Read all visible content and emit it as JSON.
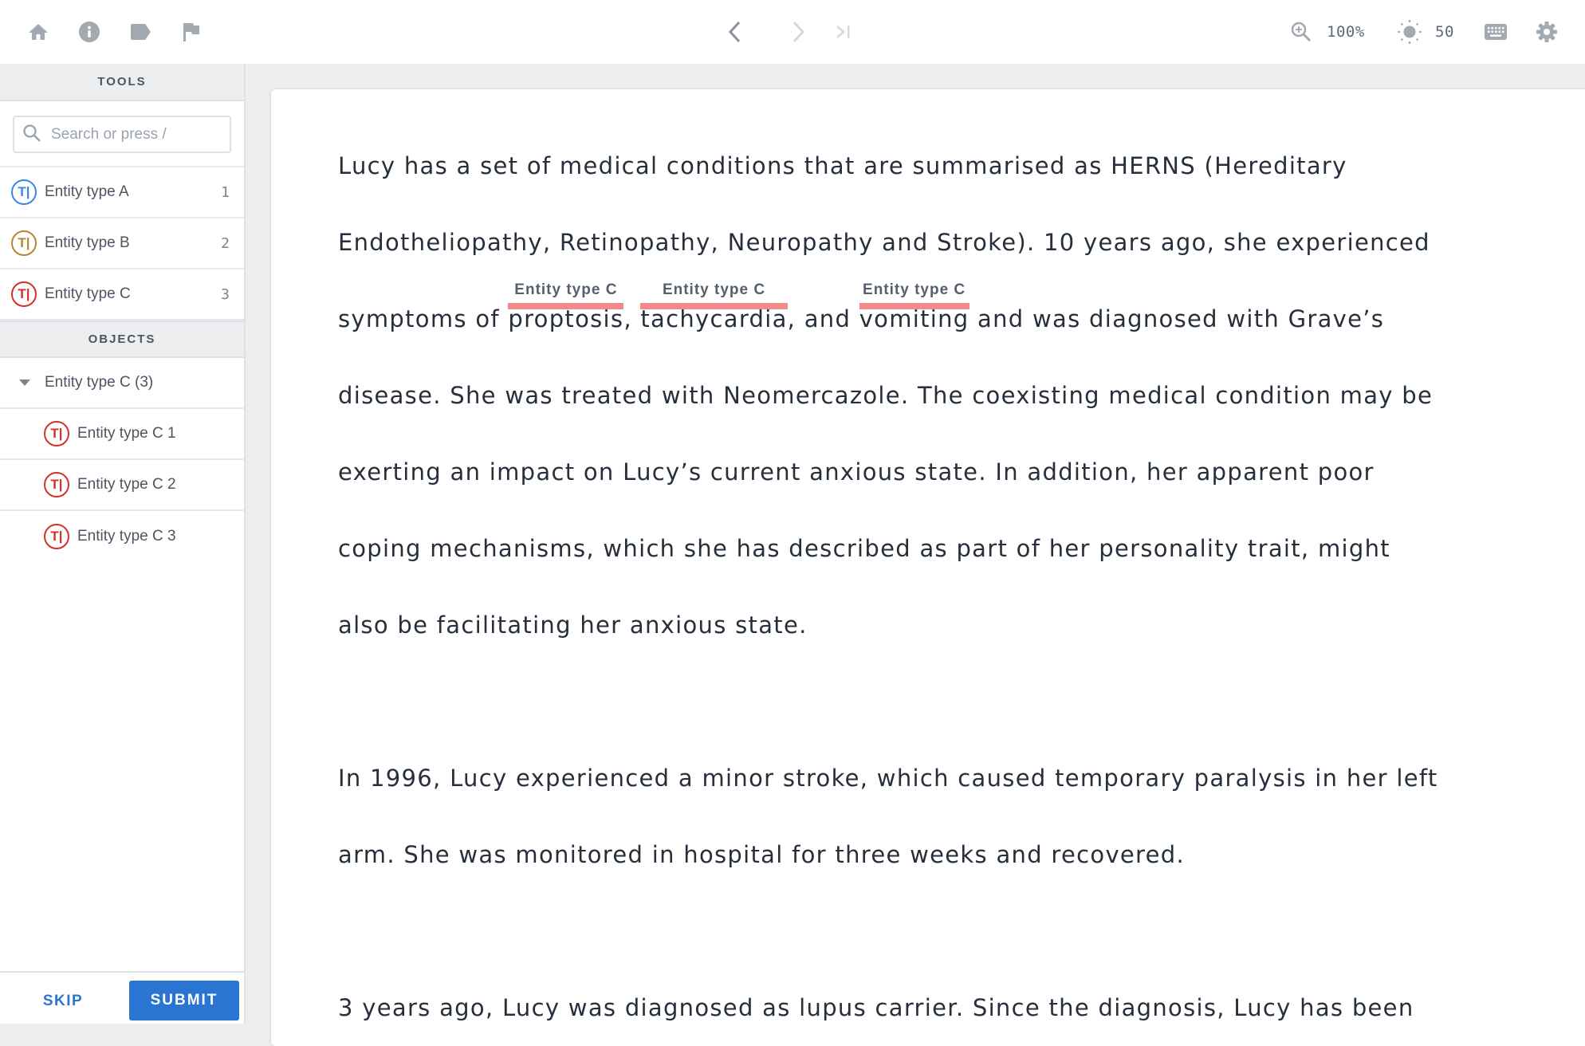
{
  "topbar": {
    "left_icons": [
      "home-icon",
      "info-icon",
      "label-icon",
      "flag-icon"
    ],
    "nav": [
      "previous-icon",
      "next-icon",
      "last-icon"
    ],
    "zoom_value": "100%",
    "brightness_value": "50",
    "right_icons": [
      "zoom-in-icon",
      "brightness-icon",
      "keyboard-icon",
      "settings-icon"
    ]
  },
  "sidebar": {
    "tools_header": "TOOLS",
    "search": {
      "placeholder": "Search or press /",
      "value": ""
    },
    "tools": [
      {
        "badge": "T|",
        "label": "Entity type A",
        "count": "1",
        "color": "#3b86e6"
      },
      {
        "badge": "T|",
        "label": "Entity type B",
        "count": "2",
        "color": "#b8862f"
      },
      {
        "badge": "T|",
        "label": "Entity type C",
        "count": "3",
        "color": "#d62f27"
      }
    ],
    "objects_header": "OBJECTS",
    "object_group": {
      "label": "Entity type C (3)",
      "expanded": true
    },
    "objects": [
      {
        "badge": "T|",
        "label": "Entity type C 1",
        "color": "#d62f27"
      },
      {
        "badge": "T|",
        "label": "Entity type C 2",
        "color": "#d62f27"
      },
      {
        "badge": "T|",
        "label": "Entity type C 3",
        "color": "#d62f27"
      }
    ],
    "skip_label": "SKIP",
    "submit_label": "SUBMIT"
  },
  "document": {
    "annotation_color": "#ef8c8a",
    "lines": {
      "l1": "Lucy has a set of medical conditions that are summarised as HERNS (Hereditary",
      "l2": "Endotheliopathy, Retinopathy, Neuropathy and Stroke). 10 years ago, she experienced",
      "l3_pre": "symptoms of ",
      "l3_a1": "proptosis",
      "l3_mid1": ", ",
      "l3_a2": "tachycardia",
      "l3_mid2": ", and ",
      "l3_a3": "vomiting",
      "l3_post": " and was diagnosed with Grave’s",
      "l4": "disease. She was treated with Neomercazole. The coexisting medical condition may be",
      "l5": "exerting an impact on Lucy’s current anxious state. In addition, her apparent poor",
      "l6": "coping mechanisms, which she has described as part of her personality trait, might",
      "l7": "also be facilitating her anxious state.",
      "l8": "In 1996, Lucy experienced a minor stroke, which caused temporary paralysis in her left",
      "l9": "arm. She was monitored in hospital for three weeks and recovered.",
      "l10": "3 years ago, Lucy was diagnosed as lupus carrier. Since the diagnosis, Lucy has been"
    },
    "annotations": [
      {
        "text": "proptosis",
        "label": "Entity type C"
      },
      {
        "text": "tachycardia",
        "label": "Entity type C"
      },
      {
        "text": "vomiting",
        "label": "Entity type C"
      }
    ]
  }
}
